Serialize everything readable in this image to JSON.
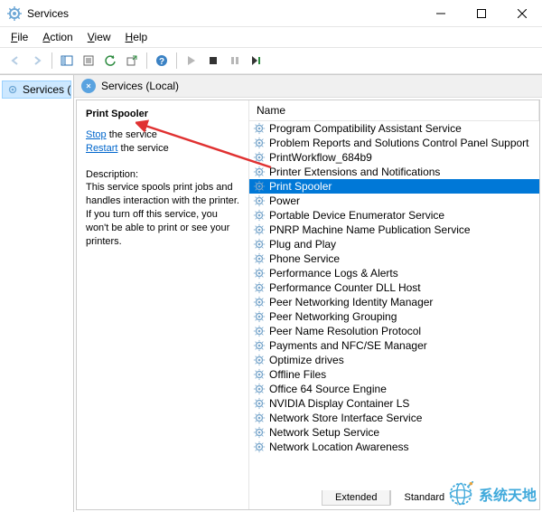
{
  "window": {
    "title": "Services"
  },
  "menubar": {
    "file": "File",
    "action": "Action",
    "view": "View",
    "help": "Help"
  },
  "left": {
    "tree_label": "Services (Loca"
  },
  "pane": {
    "header": "Services (Local)"
  },
  "detail": {
    "service_name": "Print Spooler",
    "stop_link": "Stop",
    "stop_suffix": " the service",
    "restart_link": "Restart",
    "restart_suffix": " the service",
    "desc_label": "Description:",
    "desc_text": "This service spools print jobs and handles interaction with the printer. If you turn off this service, you won't be able to print or see your printers."
  },
  "list": {
    "header_name": "Name",
    "items": [
      {
        "name": "Program Compatibility Assistant Service",
        "selected": false
      },
      {
        "name": "Problem Reports and Solutions Control Panel Support",
        "selected": false
      },
      {
        "name": "PrintWorkflow_684b9",
        "selected": false
      },
      {
        "name": "Printer Extensions and Notifications",
        "selected": false
      },
      {
        "name": "Print Spooler",
        "selected": true
      },
      {
        "name": "Power",
        "selected": false
      },
      {
        "name": "Portable Device Enumerator Service",
        "selected": false
      },
      {
        "name": "PNRP Machine Name Publication Service",
        "selected": false
      },
      {
        "name": "Plug and Play",
        "selected": false
      },
      {
        "name": "Phone Service",
        "selected": false
      },
      {
        "name": "Performance Logs & Alerts",
        "selected": false
      },
      {
        "name": "Performance Counter DLL Host",
        "selected": false
      },
      {
        "name": "Peer Networking Identity Manager",
        "selected": false
      },
      {
        "name": "Peer Networking Grouping",
        "selected": false
      },
      {
        "name": "Peer Name Resolution Protocol",
        "selected": false
      },
      {
        "name": "Payments and NFC/SE Manager",
        "selected": false
      },
      {
        "name": "Optimize drives",
        "selected": false
      },
      {
        "name": "Offline Files",
        "selected": false
      },
      {
        "name": "Office 64 Source Engine",
        "selected": false
      },
      {
        "name": "NVIDIA Display Container LS",
        "selected": false
      },
      {
        "name": "Network Store Interface Service",
        "selected": false
      },
      {
        "name": "Network Setup Service",
        "selected": false
      },
      {
        "name": "Network Location Awareness",
        "selected": false
      }
    ]
  },
  "tabs": {
    "extended": "Extended",
    "standard": "Standard"
  },
  "watermark": "系统天地"
}
